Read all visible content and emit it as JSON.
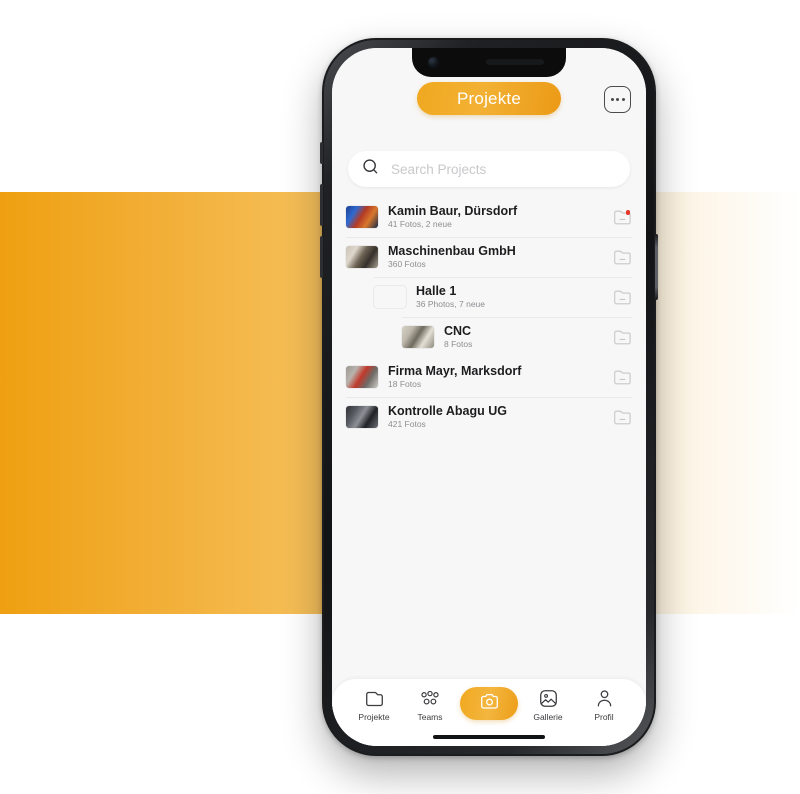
{
  "background": {
    "band_gradient_from": "#efa011",
    "band_gradient_to": "#ffffff"
  },
  "theme": {
    "accent": "#f0a81f",
    "accent_dark": "#eb9a16",
    "badge_red": "#e8352a",
    "screen_bg": "#f7f7f7",
    "text_primary": "#1d1d1f",
    "text_secondary": "#8e8e93"
  },
  "header": {
    "title": "Projekte",
    "more_icon": "more-horizontal-icon"
  },
  "search": {
    "placeholder": "Search Projects",
    "value": "",
    "icon": "search-icon"
  },
  "list": {
    "items": [
      {
        "title": "Kamin Baur, Dürsdorf",
        "subtitle": "41 Fotos, 2 neue",
        "level": 0,
        "folder_icon": "folder-collapse-icon",
        "has_badge": true,
        "thumb_colors": [
          "#1d3f8e",
          "#2f6ad0",
          "#b43a24",
          "#d8782c",
          "#1b2a4a"
        ]
      },
      {
        "title": "Maschinenbau GmbH",
        "subtitle": "360 Fotos",
        "level": 0,
        "folder_icon": "folder-collapse-icon",
        "has_badge": false,
        "thumb_colors": [
          "#cbc3b6",
          "#ded7cb",
          "#6d6354",
          "#35302a",
          "#a8a093"
        ]
      },
      {
        "title": "Halle 1",
        "subtitle": "36 Photos, 7 neue",
        "level": 1,
        "folder_icon": "folder-collapse-icon",
        "has_badge": false,
        "thumb_colors": [
          "#8d8madd",
          "#7b7568",
          "#cfc9bd",
          "#4e4940",
          "#9a9286"
        ]
      },
      {
        "title": "CNC",
        "subtitle": "8 Fotos",
        "level": 2,
        "folder_icon": "folder-collapse-icon",
        "has_badge": false,
        "thumb_colors": [
          "#d6d2c6",
          "#bdb8ab",
          "#6f6a5e",
          "#e4e0d6",
          "#8e8a7d"
        ]
      },
      {
        "title": "Firma Mayr, Marksdorf",
        "subtitle": "18 Fotos",
        "level": 0,
        "folder_icon": "folder-collapse-icon",
        "has_badge": false,
        "thumb_colors": [
          "#9b9792",
          "#b8b3ac",
          "#c0392b",
          "#6d6a66",
          "#d2cec8"
        ]
      },
      {
        "title": "Kontrolle Abagu UG",
        "subtitle": "421 Fotos",
        "level": 0,
        "folder_icon": "folder-collapse-icon",
        "has_badge": false,
        "thumb_colors": [
          "#2f3136",
          "#55585e",
          "#8d9096",
          "#1f2125",
          "#6e7278"
        ]
      }
    ]
  },
  "tabbar": {
    "items": [
      {
        "label": "Projekte",
        "icon": "folder-icon",
        "active": false
      },
      {
        "label": "Teams",
        "icon": "people-icon",
        "active": false
      },
      {
        "label": "Gallerie",
        "icon": "image-icon",
        "active": false
      },
      {
        "label": "Profil",
        "icon": "person-icon",
        "active": false
      }
    ],
    "camera": {
      "icon": "camera-icon",
      "label": ""
    }
  }
}
